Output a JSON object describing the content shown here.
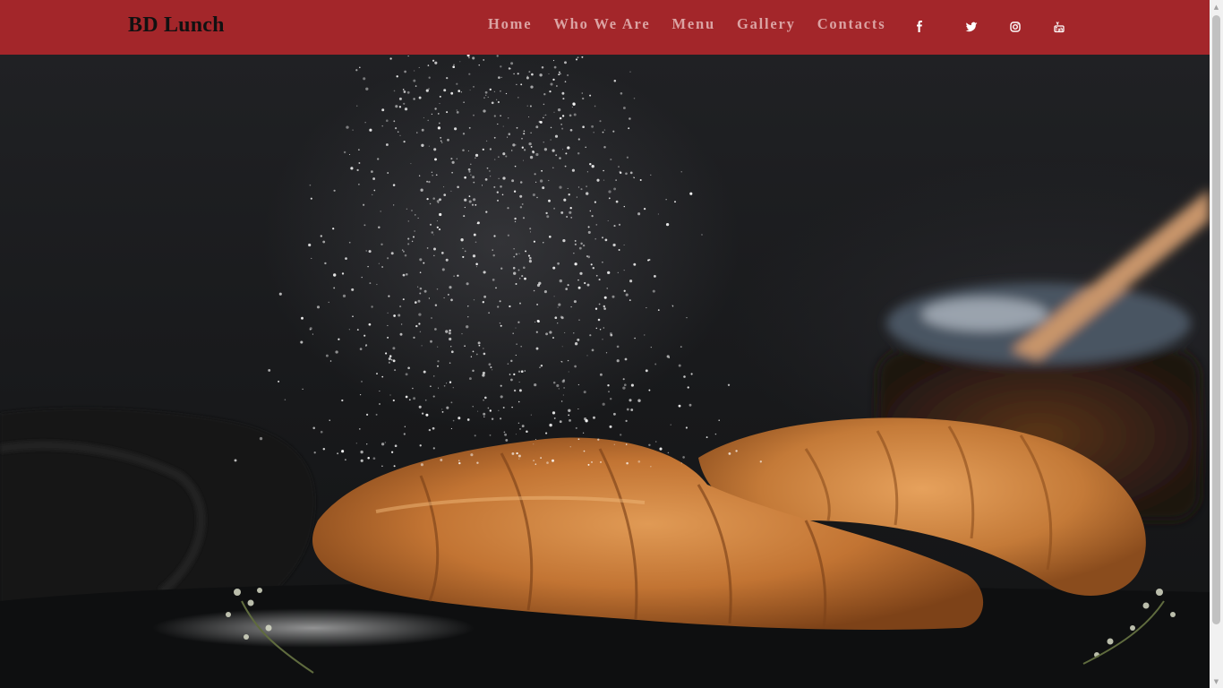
{
  "header": {
    "brand": "BD Lunch",
    "nav": [
      {
        "label": "Home"
      },
      {
        "label": "Who We Are"
      },
      {
        "label": "Menu"
      },
      {
        "label": "Gallery"
      },
      {
        "label": "Contacts"
      }
    ],
    "social_icons": [
      "facebook-icon",
      "twitter-icon",
      "instagram-icon",
      "youtube-icon"
    ]
  },
  "hero": {
    "image_subject": "croissants-dusted-with-powdered-sugar"
  },
  "scrollbar": {
    "up_arrow": "▲",
    "down_arrow": "▼"
  },
  "colors": {
    "navbar_bg": "#a3262a",
    "nav_link": "#dba3a3",
    "brand_text": "#111111",
    "croissant": "#c97a37"
  }
}
